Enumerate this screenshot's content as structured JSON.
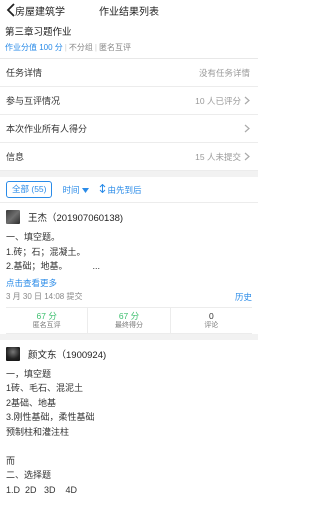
{
  "nav": {
    "course": "房屋建筑学",
    "title": "作业结果列表"
  },
  "homework": {
    "name": "第三章习题作业",
    "score_label": "作业分值 100 分",
    "grouping": "不分组",
    "review_mode": "匿名互评"
  },
  "rows": [
    {
      "label": "任务详情",
      "value": "没有任务详情",
      "chevron": false
    },
    {
      "label": "参与互评情况",
      "value": "10 人已评分",
      "chevron": true
    },
    {
      "label": "本次作业所有人得分",
      "value": "",
      "chevron": true
    },
    {
      "label": "信息",
      "value": "15 人未提交",
      "chevron": true
    }
  ],
  "filters": {
    "all": "全部 (55)",
    "time": "时间",
    "order": "由先到后"
  },
  "submission1": {
    "name": "王杰（201907060138)",
    "answer": "一、填空题。\n1.砖；石；混凝土。\n2.基础；地基。          ...",
    "more": "点击查看更多",
    "time": "3 月 30 日 14:08 提交",
    "history": "历史",
    "stats": [
      {
        "value": "67 分",
        "label": "匿名互评",
        "color": "green"
      },
      {
        "value": "67 分",
        "label": "最终得分",
        "color": "green"
      },
      {
        "value": "0",
        "label": "评论",
        "color": "dark"
      }
    ]
  },
  "submission2": {
    "name": "颜文东（1900924)",
    "answer": "一，填空题\n1砖、毛石、混泥土\n2基础、地基\n3.刚性基础，柔性基础\n预制柱和灌注柱\n\n而\n二、选择题\n1.D  2D   3D    4D"
  },
  "colors": {
    "accent": "#2a8be8",
    "green": "#3cbf6e"
  }
}
